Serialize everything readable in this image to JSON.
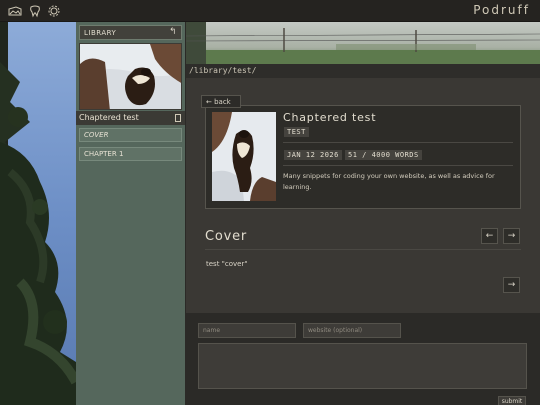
{
  "app": {
    "brand": "Podruff"
  },
  "topbar": {
    "icons": [
      "image-stack-icon",
      "tooth-icon",
      "settings-icon"
    ]
  },
  "sidebar": {
    "library_label": "LIBRARY",
    "back_icon": "return-arrow-icon",
    "book_title": "Chaptered test",
    "book_icon": "book-icon",
    "chapters": [
      {
        "label": "COVER",
        "active": true
      },
      {
        "label": "CHAPTER 1",
        "active": false
      }
    ]
  },
  "main": {
    "path": "/library/test/",
    "back_label": "← back",
    "book": {
      "title": "Chaptered test",
      "tag": "TEST",
      "date": "JAN 12 2026",
      "word_count": "51 / 4000 WORDS",
      "description": "Many snippets for coding your own website, as well as advice for learning."
    },
    "section": {
      "title": "Cover",
      "text": "test \"cover\"",
      "prev_icon": "arrow-left-icon",
      "next_icon": "arrow-right-icon"
    }
  },
  "form": {
    "name_placeholder": "name",
    "website_placeholder": "website (optional)",
    "submit_label": "submit"
  },
  "colors": {
    "sidebar": "#55675c",
    "panel": "#3a3834",
    "topbar": "#252320",
    "text": "#d9d4c7"
  }
}
